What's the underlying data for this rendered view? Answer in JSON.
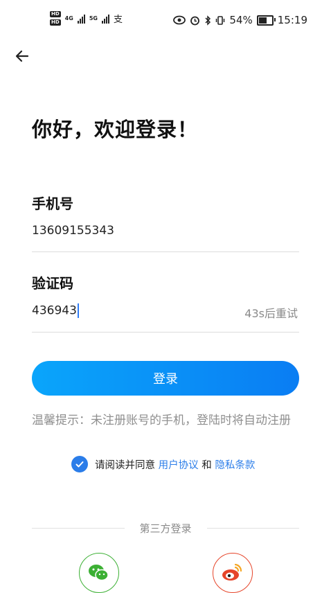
{
  "status_bar": {
    "hd1": "HD",
    "hd2": "HD",
    "net1": "4G",
    "net2": "5G",
    "app_glyph": "支",
    "battery": "54%",
    "time": "15:19"
  },
  "nav": {
    "back_icon": "arrow-left-icon"
  },
  "title": "你好，欢迎登录！",
  "phone": {
    "label": "手机号",
    "value": "13609155343"
  },
  "code": {
    "label": "验证码",
    "value": "436943",
    "resend": "43s后重试"
  },
  "login_button": "登录",
  "tip": "温馨提示：未注册账号的手机，登陆时将自动注册",
  "agreement": {
    "prefix": "请阅读并同意",
    "user_agreement": "用户协议",
    "and": "和",
    "privacy": "隐私条款",
    "checked": true
  },
  "third_party": {
    "label": "第三方登录",
    "providers": [
      "wechat-icon",
      "weibo-icon"
    ]
  },
  "colors": {
    "accent": "#2b7de9",
    "button_start": "#0aa5fb",
    "button_end": "#0a7df3",
    "wechat": "#3cb034",
    "weibo": "#e6452a"
  }
}
